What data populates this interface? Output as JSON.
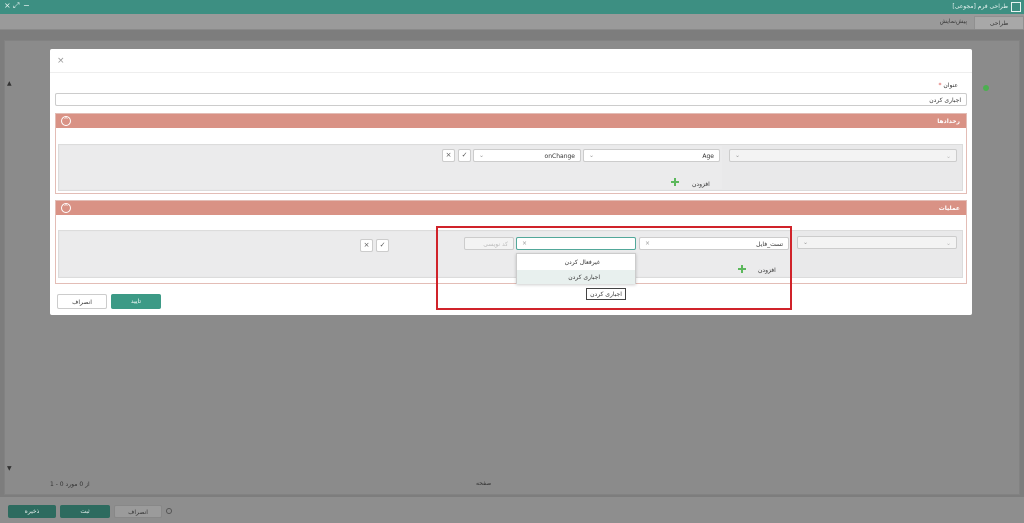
{
  "window": {
    "title": "طراحی فرم [مجوعی]",
    "controls": [
      "×",
      "⤢",
      "−"
    ]
  },
  "background": {
    "tab_active": "طراحی",
    "tab_preview": "پیش‌نمایش",
    "pager_text": "1 - 0 از 0 مورد",
    "page_label": "صفحه",
    "footer_buttons": {
      "save": "ذخیره",
      "submit": "ثبت",
      "cancel": "انصراف"
    }
  },
  "modal": {
    "title_label": "عنوان",
    "title_value": "اجباری کردن",
    "events_panel": {
      "label": "رخدادها",
      "field_value": "Age",
      "event_value": "onChange",
      "add_label": "افزودن"
    },
    "actions_panel": {
      "label": "عملیات",
      "target_value": "تست_فایل",
      "action_placeholder": "",
      "value_placeholder": "کد نویسی",
      "add_label": "افزودن"
    },
    "dropdown_options": [
      "غیرفعال کردن",
      "اجباری کردن"
    ],
    "tooltip": "اجباری کردن",
    "ok_label": "تایید",
    "cancel_label": "انصراف"
  },
  "colors": {
    "titlebar": "#3d8f82",
    "panel_header": "#d99285",
    "primary_button": "#3c9a86",
    "annotation_box": "#d0232a"
  }
}
